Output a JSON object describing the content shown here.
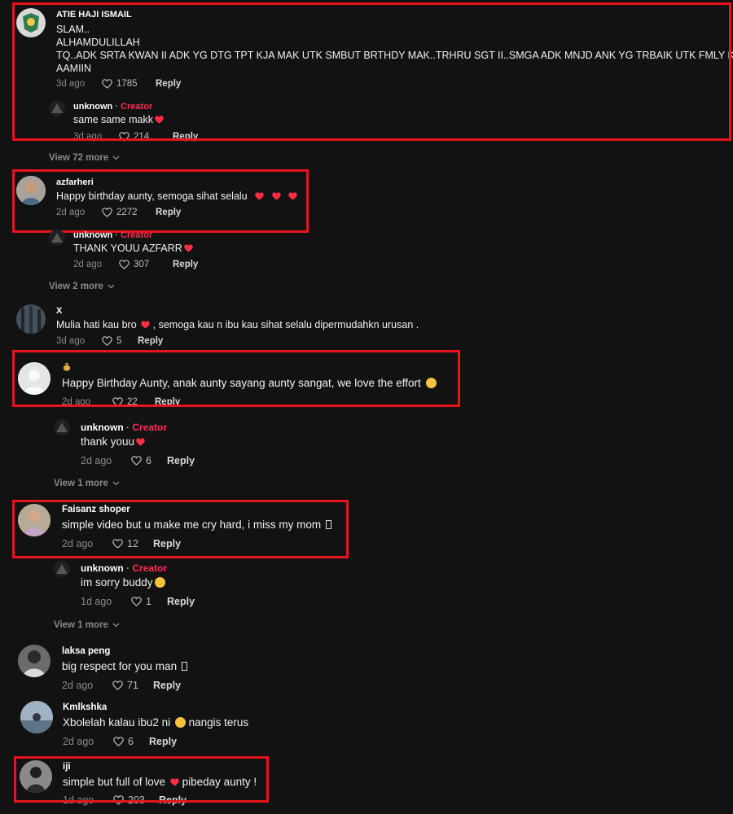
{
  "comments": [
    {
      "user": "ATIE HAJI ISMAIL",
      "lines": [
        "SLAM..",
        "ALHAMDULILLAH",
        "TQ..ADK SRTA KWAN II ADK YG DTG TPT KJA MAK UTK SMBUT BRTHDY MAK..TRHRU SGT II..SMGA ADK MNJD ANK YG TRBAIK UTK FMLY KTA",
        "AAMIIN"
      ],
      "age": "3d ago",
      "likes": "1785",
      "reply": "Reply",
      "replies": [
        {
          "user": "unknown",
          "sep": "·",
          "badge": "Creator",
          "text": "same same makk",
          "age": "3d ago",
          "likes": "214",
          "reply": "Reply"
        }
      ],
      "view_more": "View 72 more"
    },
    {
      "user": "azfarheri",
      "text": "Happy birthday aunty, semoga sihat selalu",
      "age": "2d ago",
      "likes": "2272",
      "reply": "Reply",
      "replies": [
        {
          "user": "unknown",
          "sep": "·",
          "badge": "Creator",
          "text": "THANK YOUU AZFARR",
          "age": "2d ago",
          "likes": "307",
          "reply": "Reply"
        }
      ],
      "view_more": "View 2 more"
    },
    {
      "user": "X",
      "text_a": "Mulia hati kau bro",
      "text_b": ", semoga kau n ibu kau sihat selalu dipermudahkn urusan .",
      "age": "3d ago",
      "likes": "5",
      "reply": "Reply"
    },
    {
      "user": "",
      "text": "Happy Birthday Aunty, anak aunty sayang aunty sangat, we love the effort",
      "age": "2d ago",
      "likes": "22",
      "reply": "Reply",
      "replies": [
        {
          "user": "unknown",
          "sep": "·",
          "badge": "Creator",
          "text": "thank youu",
          "age": "2d ago",
          "likes": "6",
          "reply": "Reply"
        }
      ],
      "view_more": "View 1 more"
    },
    {
      "user": "Faisanz shoper",
      "text": "simple video but u make me cry hard, i miss my mom",
      "age": "2d ago",
      "likes": "12",
      "reply": "Reply",
      "replies": [
        {
          "user": "unknown",
          "sep": "·",
          "badge": "Creator",
          "text": "im sorry buddy",
          "age": "1d ago",
          "likes": "1",
          "reply": "Reply"
        }
      ],
      "view_more": "View 1 more"
    },
    {
      "user": "laksa peng",
      "text": "big respect for you man",
      "age": "2d ago",
      "likes": "71",
      "reply": "Reply"
    },
    {
      "user": "Kmlkshka",
      "text_a": "Xbolelah kalau ibu2 ni",
      "text_b": "nangis terus",
      "age": "2d ago",
      "likes": "6",
      "reply": "Reply"
    },
    {
      "user": "iji",
      "text_a": "simple but full of love",
      "text_b": "pibeday aunty !",
      "age": "1d ago",
      "likes": "203",
      "reply": "Reply"
    }
  ],
  "colors": {
    "background": "#121212",
    "creator": "#fe2c55",
    "highlight_box": "#e8141c",
    "heart": "#ff2d44"
  }
}
